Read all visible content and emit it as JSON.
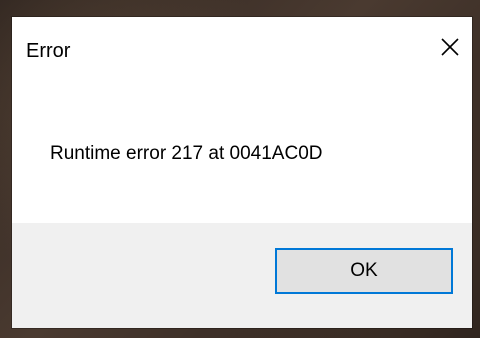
{
  "window": {
    "title": "Error",
    "close_icon": "close-icon"
  },
  "message": {
    "text": "Runtime error 217 at 0041AC0D"
  },
  "buttons": {
    "ok_label": "OK"
  },
  "colors": {
    "accent": "#0078d7",
    "footer_bg": "#f0f0f0",
    "button_bg": "#e1e1e1",
    "dialog_bg": "#ffffff"
  }
}
